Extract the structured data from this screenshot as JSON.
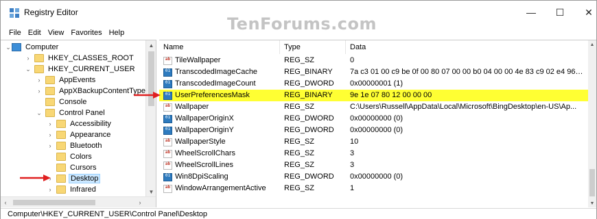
{
  "window": {
    "title": "Registry Editor",
    "watermark": "TenForums.com",
    "controls": {
      "minimize": "—",
      "maximize": "☐",
      "close": "✕"
    }
  },
  "menu": [
    "File",
    "Edit",
    "View",
    "Favorites",
    "Help"
  ],
  "tree": {
    "items": [
      {
        "label": "Computer",
        "expander": "⌄",
        "icon": "computer-icon"
      },
      {
        "label": "HKEY_CLASSES_ROOT",
        "expander": "›",
        "icon": "folder-icon"
      },
      {
        "label": "HKEY_CURRENT_USER",
        "expander": "⌄",
        "icon": "folder-icon"
      },
      {
        "label": "AppEvents",
        "expander": "›",
        "icon": "folder-icon"
      },
      {
        "label": "AppXBackupContentType",
        "expander": "›",
        "icon": "folder-icon"
      },
      {
        "label": "Console",
        "expander": "",
        "icon": "folder-icon"
      },
      {
        "label": "Control Panel",
        "expander": "⌄",
        "icon": "folder-icon"
      },
      {
        "label": "Accessibility",
        "expander": "›",
        "icon": "folder-icon"
      },
      {
        "label": "Appearance",
        "expander": "›",
        "icon": "folder-icon"
      },
      {
        "label": "Bluetooth",
        "expander": "›",
        "icon": "folder-icon"
      },
      {
        "label": "Colors",
        "expander": "",
        "icon": "folder-icon"
      },
      {
        "label": "Cursors",
        "expander": "",
        "icon": "folder-icon"
      },
      {
        "label": "Desktop",
        "expander": "›",
        "icon": "folder-icon",
        "selected": true
      },
      {
        "label": "Infrared",
        "expander": "›",
        "icon": "folder-icon"
      }
    ]
  },
  "values": {
    "columns": {
      "name": "Name",
      "type": "Type",
      "data": "Data"
    },
    "rows": [
      {
        "name": "TileWallpaper",
        "type": "REG_SZ",
        "data": "0",
        "icon": "string-value-icon"
      },
      {
        "name": "TranscodedImageCache",
        "type": "REG_BINARY",
        "data": "7a c3 01 00 c9 be 0f 00 80 07 00 00 b0 04 00 00 4e 83 c9 02 e4 96 d...",
        "icon": "binary-value-icon"
      },
      {
        "name": "TranscodedImageCount",
        "type": "REG_DWORD",
        "data": "0x00000001 (1)",
        "icon": "binary-value-icon"
      },
      {
        "name": "UserPreferencesMask",
        "type": "REG_BINARY",
        "data": "9e 1e 07 80 12 00 00 00",
        "icon": "binary-value-icon",
        "highlighted": true
      },
      {
        "name": "Wallpaper",
        "type": "REG_SZ",
        "data": "C:\\Users\\Russell\\AppData\\Local\\Microsoft\\BingDesktop\\en-US\\Ap...",
        "icon": "string-value-icon"
      },
      {
        "name": "WallpaperOriginX",
        "type": "REG_DWORD",
        "data": "0x00000000 (0)",
        "icon": "binary-value-icon"
      },
      {
        "name": "WallpaperOriginY",
        "type": "REG_DWORD",
        "data": "0x00000000 (0)",
        "icon": "binary-value-icon"
      },
      {
        "name": "WallpaperStyle",
        "type": "REG_SZ",
        "data": "10",
        "icon": "string-value-icon"
      },
      {
        "name": "WheelScrollChars",
        "type": "REG_SZ",
        "data": "3",
        "icon": "string-value-icon"
      },
      {
        "name": "WheelScrollLines",
        "type": "REG_SZ",
        "data": "3",
        "icon": "string-value-icon"
      },
      {
        "name": "Win8DpiScaling",
        "type": "REG_DWORD",
        "data": "0x00000000 (0)",
        "icon": "binary-value-icon"
      },
      {
        "name": "WindowArrangementActive",
        "type": "REG_SZ",
        "data": "1",
        "icon": "string-value-icon"
      }
    ]
  },
  "status": {
    "path": "Computer\\HKEY_CURRENT_USER\\Control Panel\\Desktop"
  },
  "colors": {
    "highlight": "#ffff33",
    "arrow": "#e02020",
    "selection": "#cce8ff"
  }
}
